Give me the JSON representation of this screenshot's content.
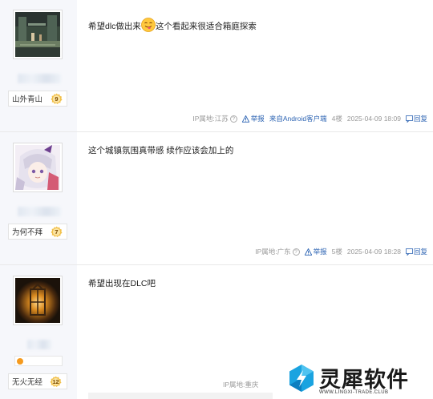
{
  "posts": [
    {
      "forum_badge": "山外青山",
      "level": "9",
      "content_before_emoji": "希望dlc做出来",
      "content_after_emoji": "这个看起来很适合箱庭探索",
      "ip": "IP属地:江苏",
      "report": "举报",
      "client": "来自Android客户端",
      "floor": "4楼",
      "time": "2025-04-09 18:09",
      "reply": "回复"
    },
    {
      "forum_badge": "为何不拜",
      "level": "7",
      "content": "这个城镇氛围真带感 续作应该会加上的",
      "ip": "IP属地:广东",
      "report": "举报",
      "floor": "5楼",
      "time": "2025-04-09 18:28",
      "reply": "回复"
    },
    {
      "forum_badge": "无火无经",
      "level": "12",
      "content": "希望出现在DLC吧",
      "ip": "IP属地:重庆"
    }
  ],
  "watermark": {
    "title": "灵犀软件",
    "subtitle": "WWW.LINGXI-TRADE.CLUB"
  },
  "colors": {
    "link": "#2d64b3",
    "sidebar_bg": "#f6f7fb",
    "badge_gold": "#f2c04a",
    "online_dot": "#f59a1e"
  }
}
